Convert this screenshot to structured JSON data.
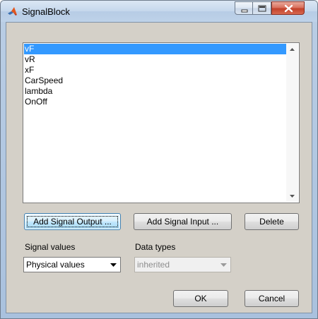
{
  "window": {
    "title": "SignalBlock"
  },
  "signal_list": {
    "items": [
      "vF",
      "vR",
      "xF",
      "CarSpeed",
      "lambda",
      "OnOff"
    ],
    "selected_index": 0
  },
  "buttons": {
    "add_output": "Add Signal Output ...",
    "add_input": "Add Signal Input ...",
    "delete": "Delete",
    "ok": "OK",
    "cancel": "Cancel"
  },
  "signal_values": {
    "label": "Signal values",
    "value": "Physical values"
  },
  "data_types": {
    "label": "Data types",
    "value": "inherited"
  },
  "colors": {
    "selection": "#3399ff",
    "dialog_background": "#d4d0c8"
  }
}
